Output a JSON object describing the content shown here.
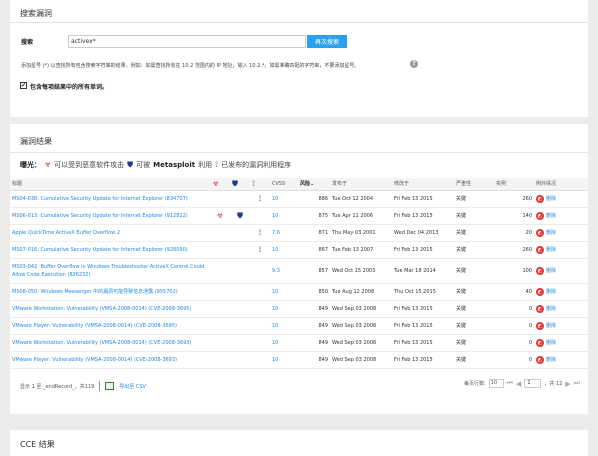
{
  "search_panel": {
    "title": "搜索漏洞",
    "search_label": "搜索",
    "search_value": "activex*",
    "search_button": "再次搜索",
    "hint": "添加星号 (*) 以查找所有包含搜索字符串的结果。例如：如需查找所有在 10.2 范围内的 IP 地址，输入 10.2.*。如需准确匹配的字符串，不要添加星号。",
    "hint_icon": "?",
    "checkbox_checked": "✔",
    "checkbox_label": "包含每项结果中的所有单词。"
  },
  "results": {
    "title": "漏洞结果",
    "legend": {
      "prefix": "曝光：",
      "malware_text": "可以受到恶意软件攻击",
      "metasploit_pre": "可被",
      "metasploit_name": "Metasploit",
      "metasploit_post": "利用",
      "exploit_text": "已发布的漏洞利用程序"
    },
    "columns": {
      "title": "标题",
      "cvss": "CVSS",
      "risk": "风险",
      "published": "发布于",
      "modified": "修改于",
      "severity": "严重性",
      "instances": "实例",
      "exceptions": "例外情况"
    },
    "sort_indicator": "⌄",
    "delete_label": "删除",
    "rows": [
      {
        "title": "MS04-038: Cumulative Security Update for Internet Explorer (834707)",
        "malware": false,
        "metasploit": false,
        "exploit": true,
        "cvss": "10",
        "risk": "886",
        "published": "Tue Oct 12 2004",
        "modified": "Fri Feb 13 2015",
        "severity": "关键",
        "instances": "260"
      },
      {
        "title": "MS06-013: Cumulative Security Update for Internet Explorer (912812)",
        "malware": true,
        "metasploit": true,
        "exploit": false,
        "cvss": "10",
        "risk": "875",
        "published": "Tue Apr 11 2006",
        "modified": "Fri Feb 13 2015",
        "severity": "关键",
        "instances": "140"
      },
      {
        "title": "Apple QuickTime ActiveX Buffer Overflow 2",
        "malware": false,
        "metasploit": false,
        "exploit": true,
        "cvss": "7.6",
        "risk": "871",
        "published": "Thu May 03 2001",
        "modified": "Wed Dec 04 2013",
        "severity": "关键",
        "instances": "20"
      },
      {
        "title": "MS07-016: Cumulative Security Update for Internet Explorer (928090)",
        "malware": false,
        "metasploit": false,
        "exploit": true,
        "cvss": "10",
        "risk": "867",
        "published": "Tue Feb 13 2007",
        "modified": "Fri Feb 13 2015",
        "severity": "关键",
        "instances": "260"
      },
      {
        "title": "MS03-042: Buffer Overflow in Windows Troubleshooter ActiveX Control Could Allow Code Execution (826232)",
        "malware": false,
        "metasploit": false,
        "exploit": false,
        "cvss": "9.3",
        "risk": "857",
        "published": "Wed Oct 15 2003",
        "modified": "Tue Mar 18 2014",
        "severity": "关键",
        "instances": "100",
        "tall": true
      },
      {
        "title": "MS08-050: Windows Messenger 中的漏洞可能导致信息泄露 (955702)",
        "malware": false,
        "metasploit": false,
        "exploit": false,
        "cvss": "10",
        "risk": "850",
        "published": "Tue Aug 12 2008",
        "modified": "Thu Oct 15 2015",
        "severity": "关键",
        "instances": "40"
      },
      {
        "title": "VMware Workstation: Vulnerability (VMSA-2008-0014) (CVE-2008-3695)",
        "malware": false,
        "metasploit": false,
        "exploit": false,
        "cvss": "10",
        "risk": "849",
        "published": "Wed Sep 03 2008",
        "modified": "Fri Feb 13 2015",
        "severity": "关键",
        "instances": "0"
      },
      {
        "title": "VMware Player: Vulnerability (VMSA-2008-0014) (CVE-2008-3695)",
        "malware": false,
        "metasploit": false,
        "exploit": false,
        "cvss": "10",
        "risk": "849",
        "published": "Wed Sep 03 2008",
        "modified": "Fri Feb 13 2015",
        "severity": "关键",
        "instances": "0"
      },
      {
        "title": "VMware Workstation: Vulnerability (VMSA-2008-0014) (CVE-2008-3693)",
        "malware": false,
        "metasploit": false,
        "exploit": false,
        "cvss": "10",
        "risk": "849",
        "published": "Wed Sep 03 2008",
        "modified": "Fri Feb 13 2015",
        "severity": "关键",
        "instances": "0"
      },
      {
        "title": "VMware Player: Vulnerability (VMSA-2008-0014) (CVE-2008-3693)",
        "malware": false,
        "metasploit": false,
        "exploit": false,
        "cvss": "10",
        "risk": "849",
        "published": "Wed Sep 03 2008",
        "modified": "Fri Feb 13 2015",
        "severity": "关键",
        "instances": "0"
      }
    ],
    "footer": {
      "showing": "显示 1 至 _endRecord_，共119",
      "export": "导出至 CSV",
      "rows_per_page_label": "每页行数:",
      "rows_per_page": "10",
      "page": "1",
      "total_pages": "，共 12"
    }
  },
  "cce": {
    "title": "CCE 结果"
  }
}
